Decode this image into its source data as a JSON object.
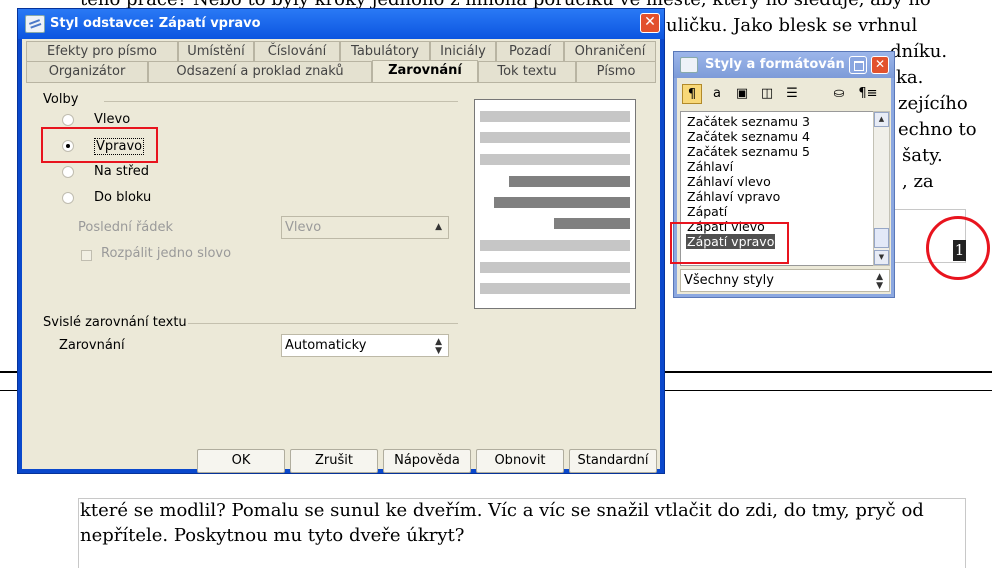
{
  "document": {
    "top_lines": [
      "tého práce? Nebo to byly kroky jednoho z mnoha poručíků ve městě, který ho sleduje, aby no",
      "uličku. Jako blesk se vrhnul",
      "dníku.",
      "ka.",
      "zejícího",
      "echno to",
      "šaty.",
      ", za"
    ],
    "page_number": "1",
    "bottom_lines": [
      "které se modlil? Pomalu se sunul ke dveřím. Víc a víc se snažil vtlačit do zdi, do tmy, pryč od",
      "nepřítele. Poskytnou mu tyto dveře úkryt?"
    ]
  },
  "dialog": {
    "title": "Styl odstavce: Zápatí vpravo",
    "close_glyph": "✕",
    "tabs_row1": [
      "Efekty pro písmo",
      "Umístění",
      "Číslování",
      "Tabulátory",
      "Iniciály",
      "Pozadí",
      "Ohraničení"
    ],
    "tabs_row2": [
      "Organizátor",
      "Odsazení a proklad znaků",
      "Zarovnání",
      "Tok textu",
      "Písmo"
    ],
    "options_label": "Volby",
    "options": [
      "Vlevo",
      "Vpravo",
      "Na střed",
      "Do bloku"
    ],
    "selected_option": "Vpravo",
    "last_line_label": "Poslední řádek",
    "last_line_value": "Vlevo",
    "stretch_label": "Rozpálit jedno slovo",
    "vertical_label": "Svislé zarovnání textu",
    "alignment_label": "Zarovnání",
    "alignment_value": "Automaticky",
    "buttons": [
      "OK",
      "Zrušit",
      "Nápověda",
      "Obnovit",
      "Standardní"
    ]
  },
  "styles_window": {
    "title": "Styly a formátován",
    "close_glyph": "✕",
    "toolbar": [
      "¶",
      "a",
      "▣",
      "◫",
      "☰",
      "⛀",
      "¶≡"
    ],
    "items": [
      "Začátek seznamu 3",
      "Začátek seznamu 4",
      "Začátek seznamu 5",
      "Záhlaví",
      "Záhlaví vlevo",
      "Záhlaví vpravo",
      "Zápatí",
      "Zápatí vlevo",
      "Zápatí vpravo"
    ],
    "selected_item": "Zápatí vpravo",
    "filter_value": "Všechny styly"
  },
  "colors": {
    "dialog_frame": "#0a48cc",
    "highlight": "#e8141e",
    "selection": "#505050"
  }
}
